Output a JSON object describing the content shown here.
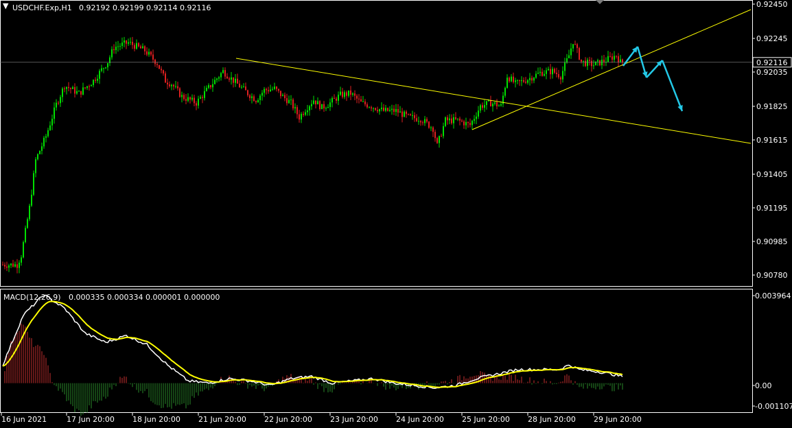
{
  "header": {
    "symbol_label": "USDCHF.Exp,H1",
    "ohlc_values": "0.92192 0.92199 0.92114 0.92116"
  },
  "macd": {
    "label": "MACD(12,26,9)",
    "values_text": "0.000335 0.000334 0.000001 0.000000"
  },
  "colors": {
    "background": "#000000",
    "bull_candle": "#00e000",
    "bear_candle": "#e02020",
    "trendline": "#ffff00",
    "forecast_arrow": "#23c8e6",
    "macd_line": "#ffffff",
    "signal_line": "#ffff00",
    "hist_positive": "#c83030",
    "hist_negative": "#2a8a2a",
    "axis_text": "#ffffff",
    "frame": "#ffffff"
  },
  "chart_data": {
    "type": "candlestick",
    "main_axis": {
      "ticks": [
        "0.92450",
        "0.92245",
        "0.92035",
        "0.91825",
        "0.91615",
        "0.91405",
        "0.91195",
        "0.90985",
        "0.90780"
      ],
      "current_price": "0.92116",
      "ylim": [
        0.9071,
        0.925
      ]
    },
    "macd_axis": {
      "ticks": [
        "0.003964",
        "0.00",
        "-0.001107"
      ],
      "ylim": [
        -0.00125,
        0.0041
      ]
    },
    "x_ticks": [
      "16 Jun 2021",
      "17 Jun 20:00",
      "18 Jun 20:00",
      "21 Jun 20:00",
      "22 Jun 20:00",
      "23 Jun 20:00",
      "24 Jun 20:00",
      "25 Jun 20:00",
      "28 Jun 20:00",
      "29 Jun 20:00"
    ],
    "price_anchors": [
      [
        0,
        0.9084
      ],
      [
        8,
        0.9084
      ],
      [
        10,
        0.909
      ],
      [
        14,
        0.912
      ],
      [
        17,
        0.915
      ],
      [
        22,
        0.9165
      ],
      [
        27,
        0.9185
      ],
      [
        31,
        0.9197
      ],
      [
        38,
        0.9192
      ],
      [
        45,
        0.92
      ],
      [
        52,
        0.9212
      ],
      [
        55,
        0.9221
      ],
      [
        62,
        0.9224
      ],
      [
        70,
        0.9219
      ],
      [
        76,
        0.9211
      ],
      [
        80,
        0.92
      ],
      [
        83,
        0.9198
      ],
      [
        88,
        0.919
      ],
      [
        95,
        0.9186
      ],
      [
        102,
        0.9197
      ],
      [
        108,
        0.9206
      ],
      [
        114,
        0.9199
      ],
      [
        120,
        0.9192
      ],
      [
        124,
        0.9188
      ],
      [
        128,
        0.9194
      ],
      [
        133,
        0.9195
      ],
      [
        137,
        0.919
      ],
      [
        141,
        0.9186
      ],
      [
        145,
        0.9177
      ],
      [
        148,
        0.9182
      ],
      [
        152,
        0.9188
      ],
      [
        156,
        0.9183
      ],
      [
        160,
        0.9186
      ],
      [
        165,
        0.9191
      ],
      [
        170,
        0.9192
      ],
      [
        175,
        0.9186
      ],
      [
        180,
        0.9184
      ],
      [
        186,
        0.9181
      ],
      [
        192,
        0.9181
      ],
      [
        198,
        0.9177
      ],
      [
        204,
        0.9176
      ],
      [
        210,
        0.917
      ],
      [
        212,
        0.9159
      ],
      [
        216,
        0.9175
      ],
      [
        222,
        0.9175
      ],
      [
        228,
        0.9172
      ],
      [
        233,
        0.9184
      ],
      [
        238,
        0.9186
      ],
      [
        243,
        0.9184
      ],
      [
        246,
        0.9203
      ],
      [
        250,
        0.9198
      ],
      [
        256,
        0.9201
      ],
      [
        262,
        0.9205
      ],
      [
        268,
        0.9206
      ],
      [
        272,
        0.9203
      ],
      [
        276,
        0.9216
      ],
      [
        278,
        0.9225
      ],
      [
        282,
        0.9212
      ],
      [
        288,
        0.921
      ],
      [
        294,
        0.9213
      ],
      [
        299,
        0.9216
      ],
      [
        301,
        0.92116
      ]
    ],
    "macd_anchors": [
      [
        0,
        0.0008
      ],
      [
        10,
        0.003
      ],
      [
        20,
        0.0039
      ],
      [
        30,
        0.0033
      ],
      [
        40,
        0.0022
      ],
      [
        50,
        0.0018
      ],
      [
        60,
        0.0021
      ],
      [
        70,
        0.0017
      ],
      [
        80,
        0.0008
      ],
      [
        90,
        0.0001
      ],
      [
        100,
        0.0
      ],
      [
        110,
        0.0002
      ],
      [
        120,
        0.0001
      ],
      [
        130,
        -0.0001
      ],
      [
        140,
        0.0002
      ],
      [
        150,
        0.0003
      ],
      [
        160,
        0.0
      ],
      [
        170,
        0.0001
      ],
      [
        180,
        0.0002
      ],
      [
        190,
        0.0
      ],
      [
        200,
        -0.0001
      ],
      [
        210,
        -0.0002
      ],
      [
        220,
        -0.0001
      ],
      [
        230,
        0.0002
      ],
      [
        240,
        0.0004
      ],
      [
        250,
        0.0006
      ],
      [
        260,
        0.0006
      ],
      [
        270,
        0.0006
      ],
      [
        275,
        0.0008
      ],
      [
        280,
        0.0006
      ],
      [
        290,
        0.0005
      ],
      [
        301,
        0.0003
      ]
    ]
  }
}
